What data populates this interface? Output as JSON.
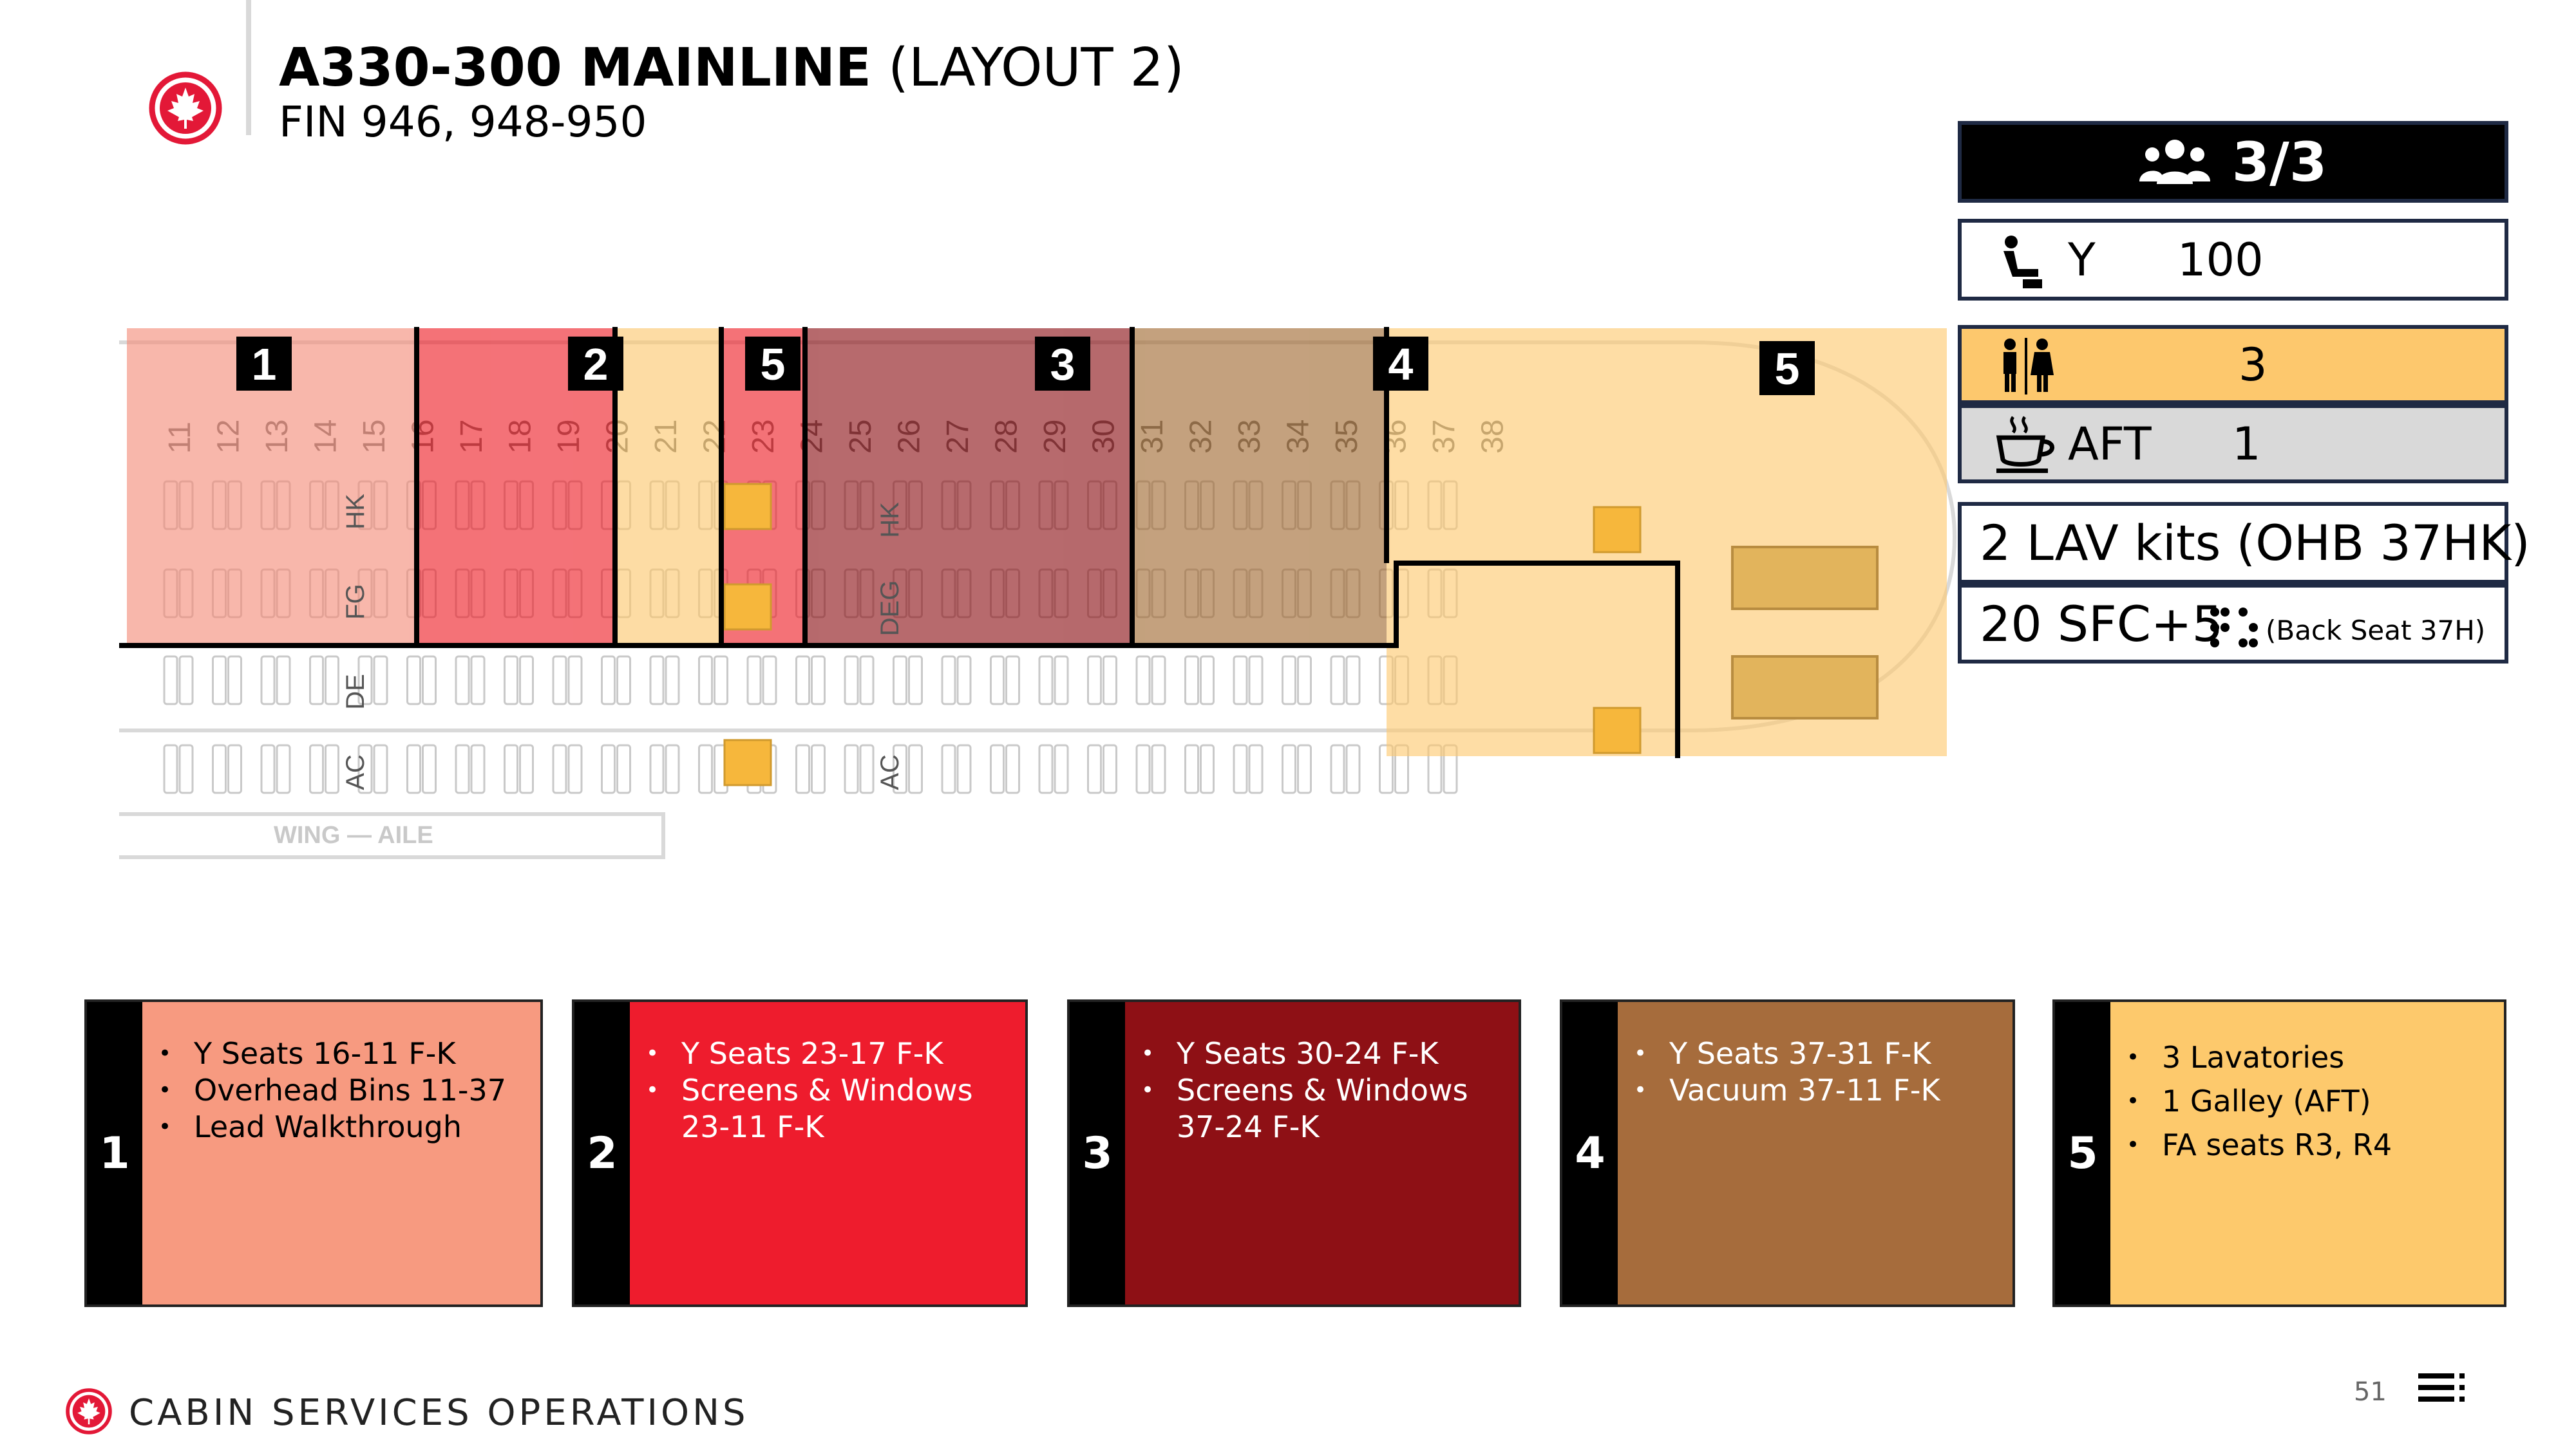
{
  "header": {
    "title_bold": "A330-300 MAINLINE",
    "title_rest": " (LAYOUT 2)",
    "subtitle": "FIN 946, 948-950"
  },
  "info_panel": {
    "crew": "3/3",
    "class_label": "Y",
    "class_count": "100",
    "lav_count": "3",
    "galley_label": "AFT",
    "galley_count": "1",
    "lav_kits": "2 LAV kits (OHB 37HK)",
    "sfc": "20 SFC+5",
    "sfc_note": "(Back Seat 37H)"
  },
  "seatmap": {
    "rows": [
      "11",
      "12",
      "13",
      "14",
      "15",
      "16",
      "17",
      "18",
      "19",
      "20",
      "21",
      "22",
      "23",
      "24",
      "25",
      "26",
      "27",
      "28",
      "29",
      "30",
      "31",
      "32",
      "33",
      "34",
      "35",
      "36",
      "37",
      "38"
    ],
    "zone_markers": [
      "1",
      "2",
      "5",
      "3",
      "4",
      "5"
    ],
    "seat_letters": [
      "HK",
      "FG",
      "DE",
      "AC",
      "HK",
      "DEG",
      "AC"
    ],
    "wing_label": "WING — AILE",
    "colors": {
      "zone1": "#f48a78",
      "zone2": "#ee1c25",
      "zone3": "#8b0f13",
      "zone4": "#a0682e",
      "zone5": "#fdc86d"
    }
  },
  "zones": [
    {
      "number": "1",
      "color": "#f79a80",
      "items": [
        "Y Seats 16-11 F-K",
        "Overhead Bins 11-37",
        "Lead Walkthrough"
      ]
    },
    {
      "number": "2",
      "color": "#ee1c2d",
      "items": [
        "Y Seats 23-17 F-K",
        "Screens & Windows 23-11 F-K"
      ]
    },
    {
      "number": "3",
      "color": "#8e1015",
      "items": [
        "Y Seats 30-24 F-K",
        "Screens & Windows 37-24 F-K"
      ]
    },
    {
      "number": "4",
      "color": "#a66c3c",
      "items": [
        "Y Seats 37-31 F-K",
        "Vacuum 37-11 F-K"
      ]
    },
    {
      "number": "5",
      "color": "#fdc96c",
      "items": [
        "3 Lavatories",
        "1 Galley (AFT)",
        "FA seats R3, R4"
      ]
    }
  ],
  "footer": {
    "org": "CABIN SERVICES OPERATIONS",
    "page": "51"
  },
  "icons": [
    "maple-leaf-logo",
    "crew-icon",
    "seat-icon",
    "lavatory-icon",
    "coffee-icon",
    "braille-icon",
    "menu-icon"
  ]
}
